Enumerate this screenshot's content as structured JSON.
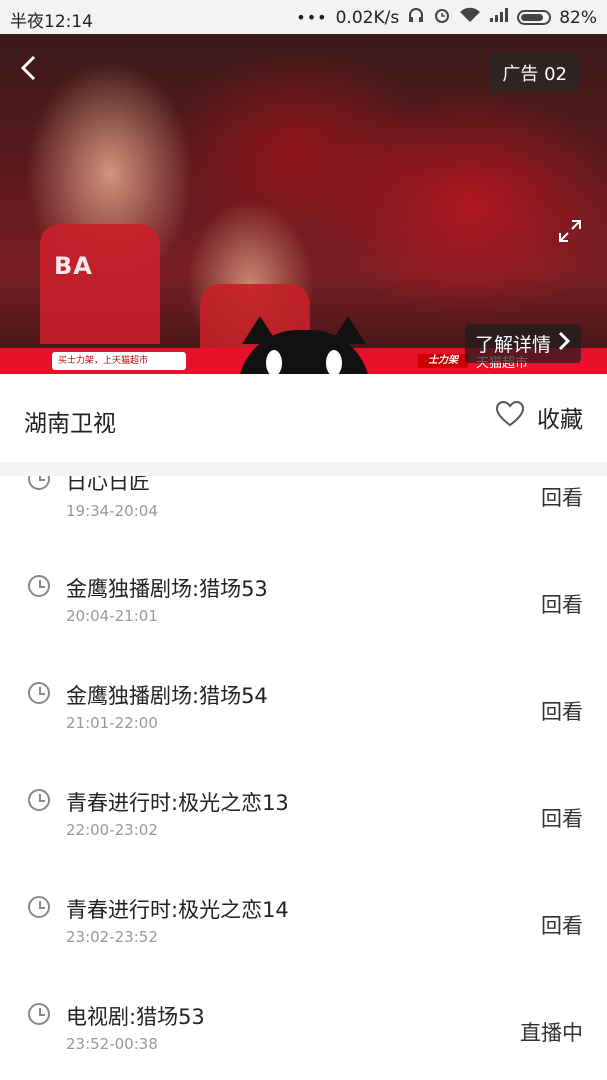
{
  "status_bar": {
    "time": "半夜12:14",
    "network_speed": "0.02K/s",
    "battery": "82%",
    "icons": [
      "more-dots-icon",
      "headphone-icon",
      "alarm-icon",
      "wifi-icon",
      "signal-icon",
      "battery-icon"
    ]
  },
  "video": {
    "ad_badge": "广告 02",
    "details_label": "了解详情",
    "ad_search_text": "买士力架，上天猫超市",
    "ad_brand_logo": "士力架",
    "ad_store_text": "天猫超市",
    "jersey_text": "BA"
  },
  "channel": {
    "name": "湖南卫视",
    "favorite_label": "收藏"
  },
  "programs": [
    {
      "title": "日心日匠",
      "time": "19:34-20:04",
      "action": "回看"
    },
    {
      "title": "金鹰独播剧场:猎场53",
      "time": "20:04-21:01",
      "action": "回看"
    },
    {
      "title": "金鹰独播剧场:猎场54",
      "time": "21:01-22:00",
      "action": "回看"
    },
    {
      "title": "青春进行时:极光之恋13",
      "time": "22:00-23:02",
      "action": "回看"
    },
    {
      "title": "青春进行时:极光之恋14",
      "time": "23:02-23:52",
      "action": "回看"
    },
    {
      "title": "电视剧:猎场53",
      "time": "23:52-00:38",
      "action": "直播中"
    }
  ]
}
